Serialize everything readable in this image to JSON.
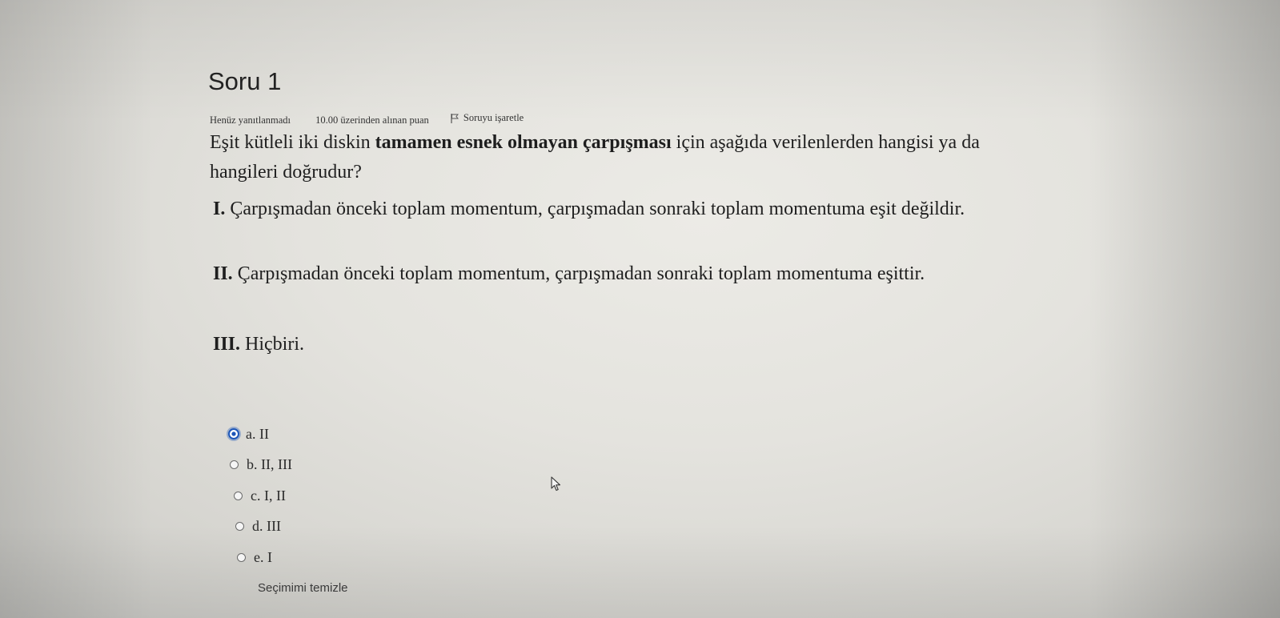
{
  "question": {
    "title": "Soru 1",
    "state": "Henüz yanıtlanmadı",
    "grade": "10.00 üzerinden alınan puan",
    "flag_label": "Soruyu işaretle",
    "text_part1": "Eşit kütleli iki diskin ",
    "text_bold": "tamamen esnek olmayan çarpışması",
    "text_part2": " için aşağıda verilenlerden hangisi ya da hangileri doğrudur?"
  },
  "statements": [
    {
      "numeral": "I.",
      "text": " Çarpışmadan önceki toplam momentum, çarpışmadan sonraki toplam momentuma eşit değildir."
    },
    {
      "numeral": "II.",
      "text": " Çarpışmadan önceki toplam momentum, çarpışmadan sonraki toplam momentuma eşittir."
    },
    {
      "numeral": "III.",
      "text": " Hiçbiri."
    }
  ],
  "answers": [
    {
      "label": "a. II",
      "selected": true
    },
    {
      "label": "b. II, III",
      "selected": false
    },
    {
      "label": "c. I, II",
      "selected": false
    },
    {
      "label": "d. III",
      "selected": false
    },
    {
      "label": "e. I",
      "selected": false
    }
  ],
  "clear_choice_label": "Seçimimi temizle",
  "icons": {
    "flag": "flag-icon",
    "cursor": "mouse-pointer-icon"
  },
  "colors": {
    "radio_selected": "#1d56b8"
  }
}
